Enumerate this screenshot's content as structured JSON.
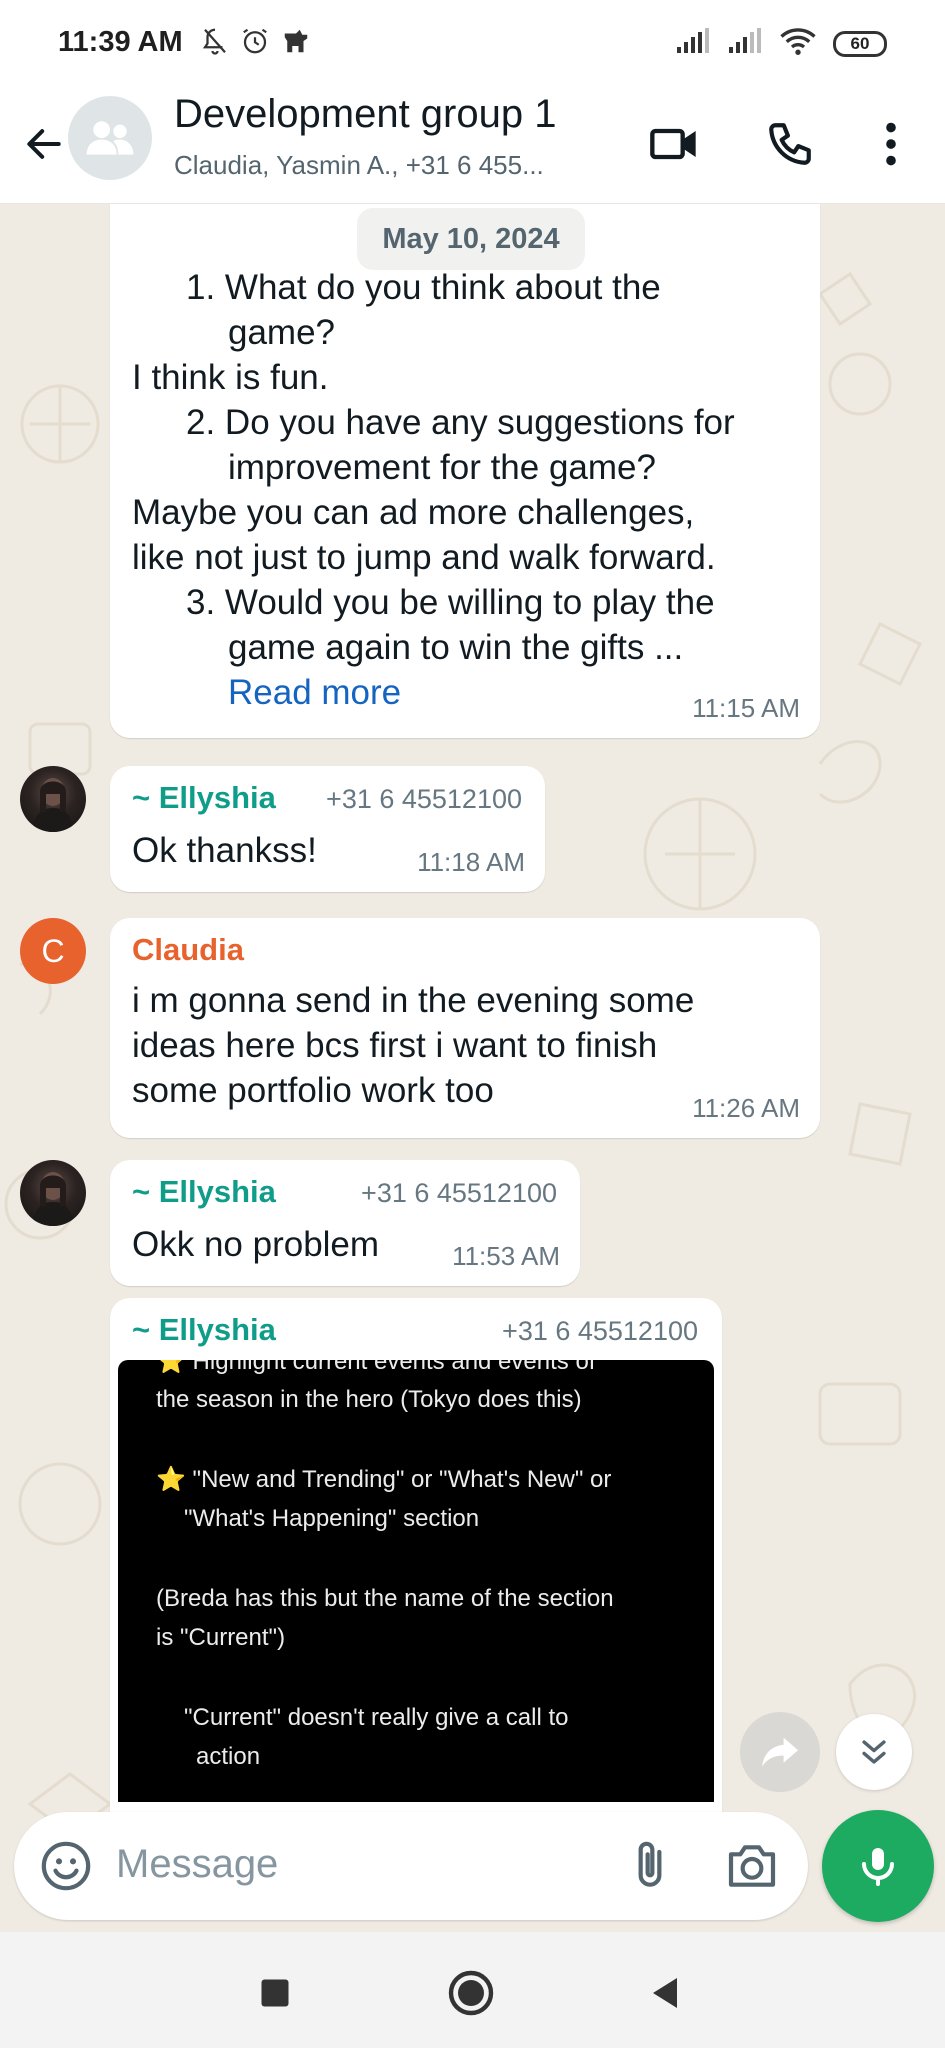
{
  "status_bar": {
    "time": "11:39 AM",
    "battery": "60",
    "icons": [
      "mute-icon",
      "alarm-icon",
      "app-icon",
      "signal-icon",
      "signal-icon",
      "wifi-icon",
      "battery-icon"
    ]
  },
  "header": {
    "title": "Development group 1",
    "subtitle": "Claudia, Yasmin A., +31 6 455...",
    "icons": [
      "back-arrow-icon",
      "group-avatar-icon",
      "video-call-icon",
      "voice-call-icon",
      "more-options-icon"
    ]
  },
  "chat": {
    "date_label": "May 10, 2024",
    "messages": [
      {
        "lines": [
          {
            "text": "1. What do you think about the",
            "indent": true
          },
          {
            "text": "game?",
            "indent2": true
          },
          {
            "text": "I think is fun.",
            "indent": false
          },
          {
            "text": "2. Do you have any suggestions for",
            "indent": true
          },
          {
            "text": "improvement for the game?",
            "indent2": true
          },
          {
            "text": "Maybe you can ad more challenges,",
            "indent": false
          },
          {
            "text": "like not just to jump and walk forward.",
            "indent": false
          },
          {
            "text": "3. Would you be willing to play the",
            "indent": true
          },
          {
            "text": "game again to win the gifts ...",
            "indent2": true
          }
        ],
        "read_more": "Read more",
        "time": "11:15 AM"
      },
      {
        "sender": "~ Ellyshia",
        "phone": "+31 6 45512100",
        "text": "Ok thankss!",
        "time": "11:18 AM"
      },
      {
        "sender": "Claudia",
        "avatar_letter": "C",
        "lines": [
          "i m gonna send in the evening some",
          "ideas here bcs first i want to finish",
          "some portfolio work too"
        ],
        "time": "11:26 AM"
      },
      {
        "sender": "~ Ellyshia",
        "phone": "+31 6 45512100",
        "text": "Okk no problem",
        "time": "11:53 AM"
      },
      {
        "sender": "~ Ellyshia",
        "phone": "+31 6 45512100",
        "image_lines": [
          "⭐ Highlight current events and events of",
          "the season in the hero (Tokyo does this)",
          "⭐ \"New and Trending\" or \"What's New\" or",
          "\"What's Happening\" section",
          "(Breda has this but the name of the section",
          "is \"Current\")",
          "\"Current\" doesn't really give a call to",
          "action"
        ]
      }
    ]
  },
  "colors": {
    "sender_ellyshia": "#0f9d8a",
    "sender_claudia": "#e8622e",
    "link": "#1565c0",
    "mic_button": "#1daa61",
    "chat_background": "#efeae2"
  },
  "input": {
    "placeholder": "Message",
    "icons": [
      "emoji-icon",
      "attach-icon",
      "camera-icon",
      "mic-icon"
    ]
  },
  "floating": {
    "icons": [
      "forward-icon",
      "scroll-down-icon"
    ]
  },
  "nav_bar": {
    "icons": [
      "recents-icon",
      "home-icon",
      "back-icon"
    ]
  }
}
